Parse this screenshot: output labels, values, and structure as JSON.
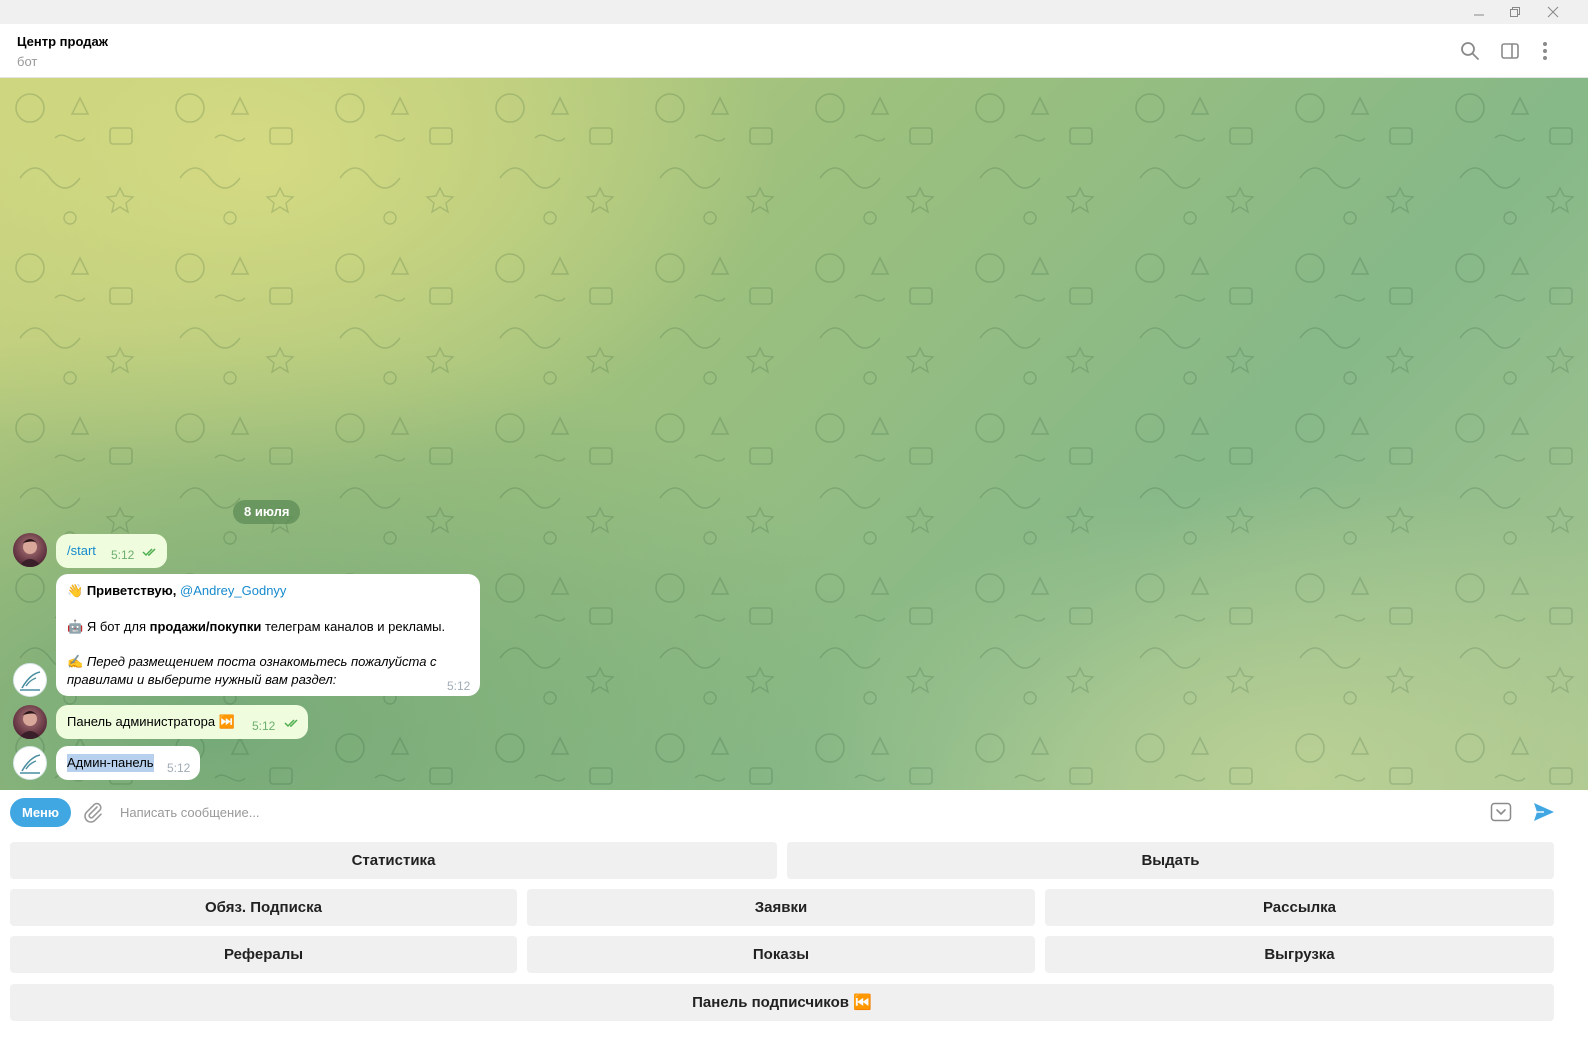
{
  "chat": {
    "title": "Центр продаж",
    "subtitle": "бот"
  },
  "date_separator": "8 июля",
  "messages": [
    {
      "text": "/start",
      "time": "5:12"
    },
    {
      "greeting_emoji": "👋",
      "greeting_bold": "Приветствую,",
      "greeting_mention": "@Andrey_Godnyy",
      "line2_emoji": "🤖",
      "line2_a": "Я бот для",
      "line2_bold": "продажи/покупки",
      "line2_b": "телеграм каналов и рекламы.",
      "line3_emoji": "✍️",
      "line3_italic_1": "Перед размещением поста ознакомьтесь пожалуйста с",
      "line3_italic_2": "правилами и выберите нужный вам раздел:",
      "time": "5:12"
    },
    {
      "text": "Панель администратора",
      "emoji": "⏭️",
      "time": "5:12"
    },
    {
      "text": "Админ-панель",
      "time": "5:12"
    }
  ],
  "compose": {
    "menu_label": "Меню",
    "placeholder": "Написать сообщение..."
  },
  "keyboard": {
    "statistics": "Статистика",
    "issue": "Выдать",
    "subscription": "Обяз. Подписка",
    "requests": "Заявки",
    "mailing": "Рассылка",
    "referrals": "Рефералы",
    "impressions": "Показы",
    "export": "Выгрузка",
    "subscribers_panel": "Панель подписчиков ⏮️"
  },
  "colors": {
    "accent": "#40a7e3",
    "outgoing_bubble": "#effdde",
    "link": "#168acd",
    "checkmarks": "#4fae4e"
  },
  "icons": [
    "minimize-icon",
    "restore-icon",
    "close-icon",
    "search-icon",
    "sidebar-toggle-icon",
    "more-vertical-icon",
    "attach-icon",
    "keyboard-toggle-icon",
    "send-icon",
    "double-check-icon"
  ]
}
